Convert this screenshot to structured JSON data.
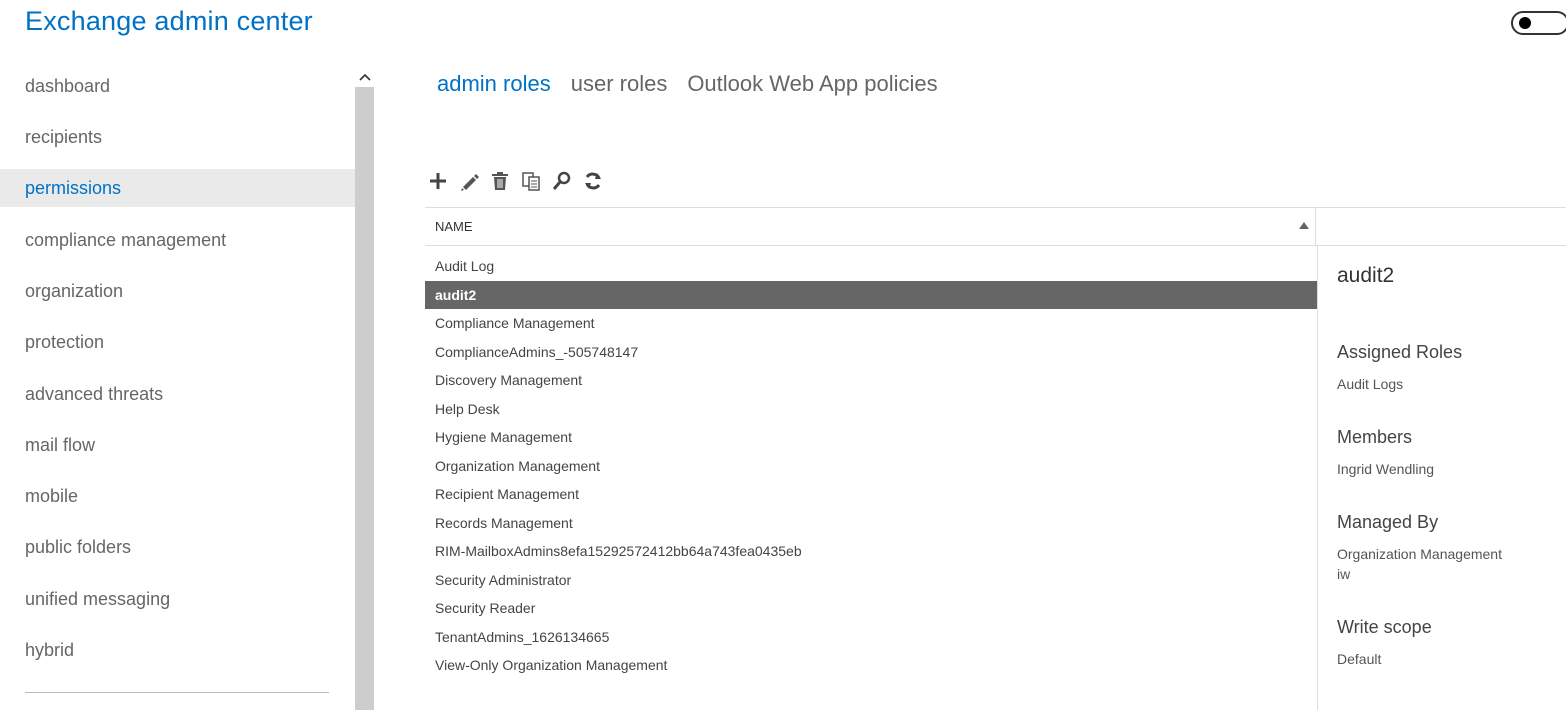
{
  "app": {
    "title": "Exchange admin center"
  },
  "sidebar": {
    "items": [
      {
        "label": "dashboard"
      },
      {
        "label": "recipients"
      },
      {
        "label": "permissions"
      },
      {
        "label": "compliance management"
      },
      {
        "label": "organization"
      },
      {
        "label": "protection"
      },
      {
        "label": "advanced threats"
      },
      {
        "label": "mail flow"
      },
      {
        "label": "mobile"
      },
      {
        "label": "public folders"
      },
      {
        "label": "unified messaging"
      },
      {
        "label": "hybrid"
      }
    ],
    "active_index": 2
  },
  "tabs": [
    {
      "label": "admin roles"
    },
    {
      "label": "user roles"
    },
    {
      "label": "Outlook Web App policies"
    }
  ],
  "toolbar": {
    "icons": [
      "add-icon",
      "edit-icon",
      "delete-icon",
      "copy-icon",
      "search-icon",
      "refresh-icon"
    ]
  },
  "list": {
    "column_name": "NAME",
    "rows": [
      "Audit Log",
      "audit2",
      "Compliance Management",
      "ComplianceAdmins_-505748147",
      "Discovery Management",
      "Help Desk",
      "Hygiene Management",
      "Organization Management",
      "Recipient Management",
      "Records Management",
      "RIM-MailboxAdmins8efa15292572412bb64a743fea0435eb",
      "Security Administrator",
      "Security Reader",
      "TenantAdmins_1626134665",
      "View-Only Organization Management"
    ],
    "selected_index": 1
  },
  "details": {
    "title": "audit2",
    "assigned_roles_label": "Assigned Roles",
    "assigned_roles_value": "Audit Logs",
    "members_label": "Members",
    "members_value": "Ingrid Wendling",
    "managed_by_label": "Managed By",
    "managed_by_value_1": "Organization Management",
    "managed_by_value_2": "iw",
    "write_scope_label": "Write scope",
    "write_scope_value": "Default"
  },
  "colors": {
    "accent": "#0072c6",
    "selected_row": "#666666",
    "nav_active_bg": "#eaeaea"
  }
}
